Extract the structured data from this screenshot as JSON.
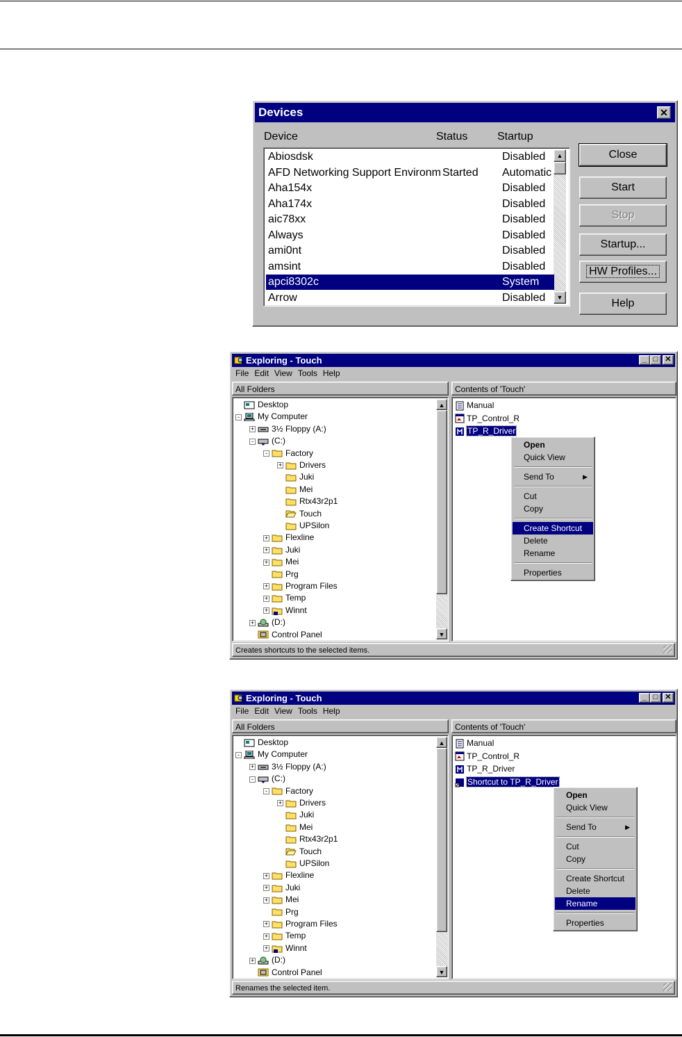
{
  "devices": {
    "title": "Devices",
    "close_x": "✕",
    "headers": {
      "device": "Device",
      "status": "Status",
      "startup": "Startup"
    },
    "rows": [
      {
        "name": "Abiosdsk",
        "status": "",
        "startup": "Disabled"
      },
      {
        "name": "AFD Networking Support Environmer",
        "status": "Started",
        "startup": "Automatic"
      },
      {
        "name": "Aha154x",
        "status": "",
        "startup": "Disabled"
      },
      {
        "name": "Aha174x",
        "status": "",
        "startup": "Disabled"
      },
      {
        "name": "aic78xx",
        "status": "",
        "startup": "Disabled"
      },
      {
        "name": "Always",
        "status": "",
        "startup": "Disabled"
      },
      {
        "name": "ami0nt",
        "status": "",
        "startup": "Disabled"
      },
      {
        "name": "amsint",
        "status": "",
        "startup": "Disabled"
      },
      {
        "name": "apci8302c",
        "status": "",
        "startup": "System"
      },
      {
        "name": "Arrow",
        "status": "",
        "startup": "Disabled"
      }
    ],
    "selected_row": 8,
    "buttons": {
      "close": "Close",
      "start": "Start",
      "stop": "Stop",
      "startup": "Startup...",
      "hw_profiles": "HW Profiles...",
      "help": "Help"
    }
  },
  "explorer1": {
    "title": "Exploring - Touch",
    "menu": [
      "File",
      "Edit",
      "View",
      "Tools",
      "Help"
    ],
    "all_folders": "All Folders",
    "contents_header": "Contents of 'Touch'",
    "tree": [
      "Desktop",
      "My Computer",
      "3½ Floppy (A:)",
      "(C:)",
      "Factory",
      "Drivers",
      "Juki",
      "Mei",
      "Rtx43r2p1",
      "Touch",
      "UPSilon",
      "Flexline",
      "Juki",
      "Mei",
      "Prg",
      "Program Files",
      "Temp",
      "Winnt",
      "(D:)",
      "Control Panel"
    ],
    "files": [
      "Manual",
      "TP_Control_R",
      "TP_R_Driver"
    ],
    "context_menu": [
      "Open",
      "Quick View",
      "Send To",
      "Cut",
      "Copy",
      "Create Shortcut",
      "Delete",
      "Rename",
      "Properties"
    ],
    "status": "Creates shortcuts to the selected items."
  },
  "explorer2": {
    "title": "Exploring - Touch",
    "menu": [
      "File",
      "Edit",
      "View",
      "Tools",
      "Help"
    ],
    "all_folders": "All Folders",
    "contents_header": "Contents of 'Touch'",
    "tree": [
      "Desktop",
      "My Computer",
      "3½ Floppy (A:)",
      "(C:)",
      "Factory",
      "Drivers",
      "Juki",
      "Mei",
      "Rtx43r2p1",
      "Touch",
      "UPSilon",
      "Flexline",
      "Juki",
      "Mei",
      "Prg",
      "Program Files",
      "Temp",
      "Winnt",
      "(D:)",
      "Control Panel"
    ],
    "files": [
      "Manual",
      "TP_Control_R",
      "TP_R_Driver",
      "Shortcut to TP_R_Driver"
    ],
    "context_menu": [
      "Open",
      "Quick View",
      "Send To",
      "Cut",
      "Copy",
      "Create Shortcut",
      "Delete",
      "Rename",
      "Properties"
    ],
    "status": "Renames the selected item."
  }
}
